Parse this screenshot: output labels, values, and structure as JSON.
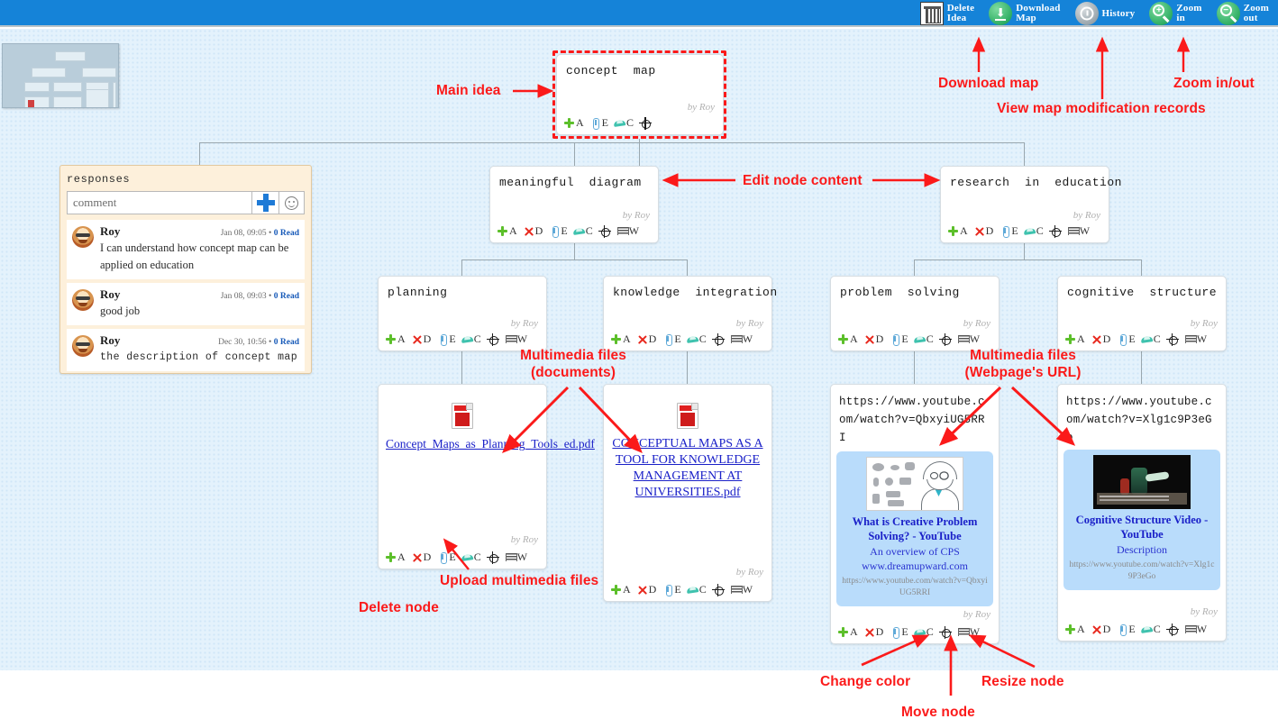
{
  "toolbar": {
    "tools": [
      {
        "name": "delete-idea",
        "icon": "trash-icon",
        "label_line1": "Delete",
        "label_line2": "Idea"
      },
      {
        "name": "download-map",
        "icon": "download-icon",
        "label_line1": "Download",
        "label_line2": "Map"
      },
      {
        "name": "history",
        "icon": "clock-icon",
        "label_line1": "History",
        "label_line2": ""
      },
      {
        "name": "zoom-in",
        "icon": "magnifier-plus-icon",
        "label_line1": "Zoom",
        "label_line2": "in",
        "sign": "+"
      },
      {
        "name": "zoom-out",
        "icon": "magnifier-minus-icon",
        "label_line1": "Zoom",
        "label_line2": "out",
        "sign": "−"
      }
    ]
  },
  "node_tools": {
    "add": "A",
    "delete": "D",
    "attach": "E",
    "color": "C",
    "resize": "W"
  },
  "nodes": {
    "main": {
      "title": "concept  map",
      "author": "by Roy"
    },
    "meaningful": {
      "title": "meaningful  diagram",
      "author": "by Roy"
    },
    "research": {
      "title": "research  in  education",
      "author": "by Roy"
    },
    "planning": {
      "title": "planning",
      "author": "by Roy"
    },
    "knowledge": {
      "title": "knowledge  integration",
      "author": "by Roy"
    },
    "problem": {
      "title": "problem  solving",
      "author": "by Roy"
    },
    "cognitive": {
      "title": "cognitive  structure",
      "author": "by Roy"
    },
    "pdf1": {
      "link": "Concept_Maps_as_Planning_Tools_ed.pdf",
      "author": "by Roy"
    },
    "pdf2": {
      "link": "CONCEPTUAL MAPS AS A TOOL FOR KNOWLEDGE MANAGEMENT AT UNIVERSITIES.pdf",
      "author": "by Roy"
    },
    "url1": {
      "url": "https://www.youtube.com/watch?v=QbxyiUG5RRI",
      "preview_title": "What is Creative Problem Solving? - YouTube",
      "preview_desc": "An overview of CPS www.dreamupward.com",
      "preview_url": "https://www.youtube.com/watch?v=QbxyiUG5RRI",
      "author": "by Roy"
    },
    "url2": {
      "url": "https://www.youtube.com/watch?v=Xlg1c9P3eGo",
      "preview_title": "Cognitive Structure Video - YouTube",
      "preview_desc": "Description",
      "preview_url": "https://www.youtube.com/watch?v=Xlg1c9P3eGo",
      "author": "by Roy"
    }
  },
  "responses": {
    "title": "responses",
    "placeholder": "comment",
    "input_value": "",
    "add_icon": "plus-icon",
    "emoji_icon": "smiley-icon",
    "items": [
      {
        "author": "Roy",
        "time": "Jan 08, 09:05",
        "sep": " • ",
        "reads": "0 Read",
        "text": "I can understand how concept map can be applied on education",
        "mono": false
      },
      {
        "author": "Roy",
        "time": "Jan 08, 09:03",
        "sep": " • ",
        "reads": "0 Read",
        "text": "good job",
        "mono": false
      },
      {
        "author": "Roy",
        "time": "Dec 30, 10:56",
        "sep": " • ",
        "reads": "0 Read",
        "text": "the description of concept map",
        "mono": true
      }
    ]
  },
  "annotations": {
    "main_idea": "Main idea",
    "edit_node": "Edit node content",
    "download_map": "Download map",
    "view_records": "View map modification records",
    "zoom_in_out": "Zoom in/out",
    "multimedia_docs": "Multimedia files\n(documents)",
    "multimedia_url": "Multimedia files\n(Webpage's URL)",
    "upload_files": "Upload multimedia files",
    "delete_node": "Delete node",
    "change_color": "Change color",
    "move_node": "Move node",
    "resize_node": "Resize node"
  },
  "colors": {
    "topbar": "#1583d8",
    "canvas": "#e4f2fc",
    "annotation": "#fb1a1a",
    "node_border": "#d6dde2",
    "responses_bg": "#fdf0db",
    "link": "#1a20c8"
  }
}
